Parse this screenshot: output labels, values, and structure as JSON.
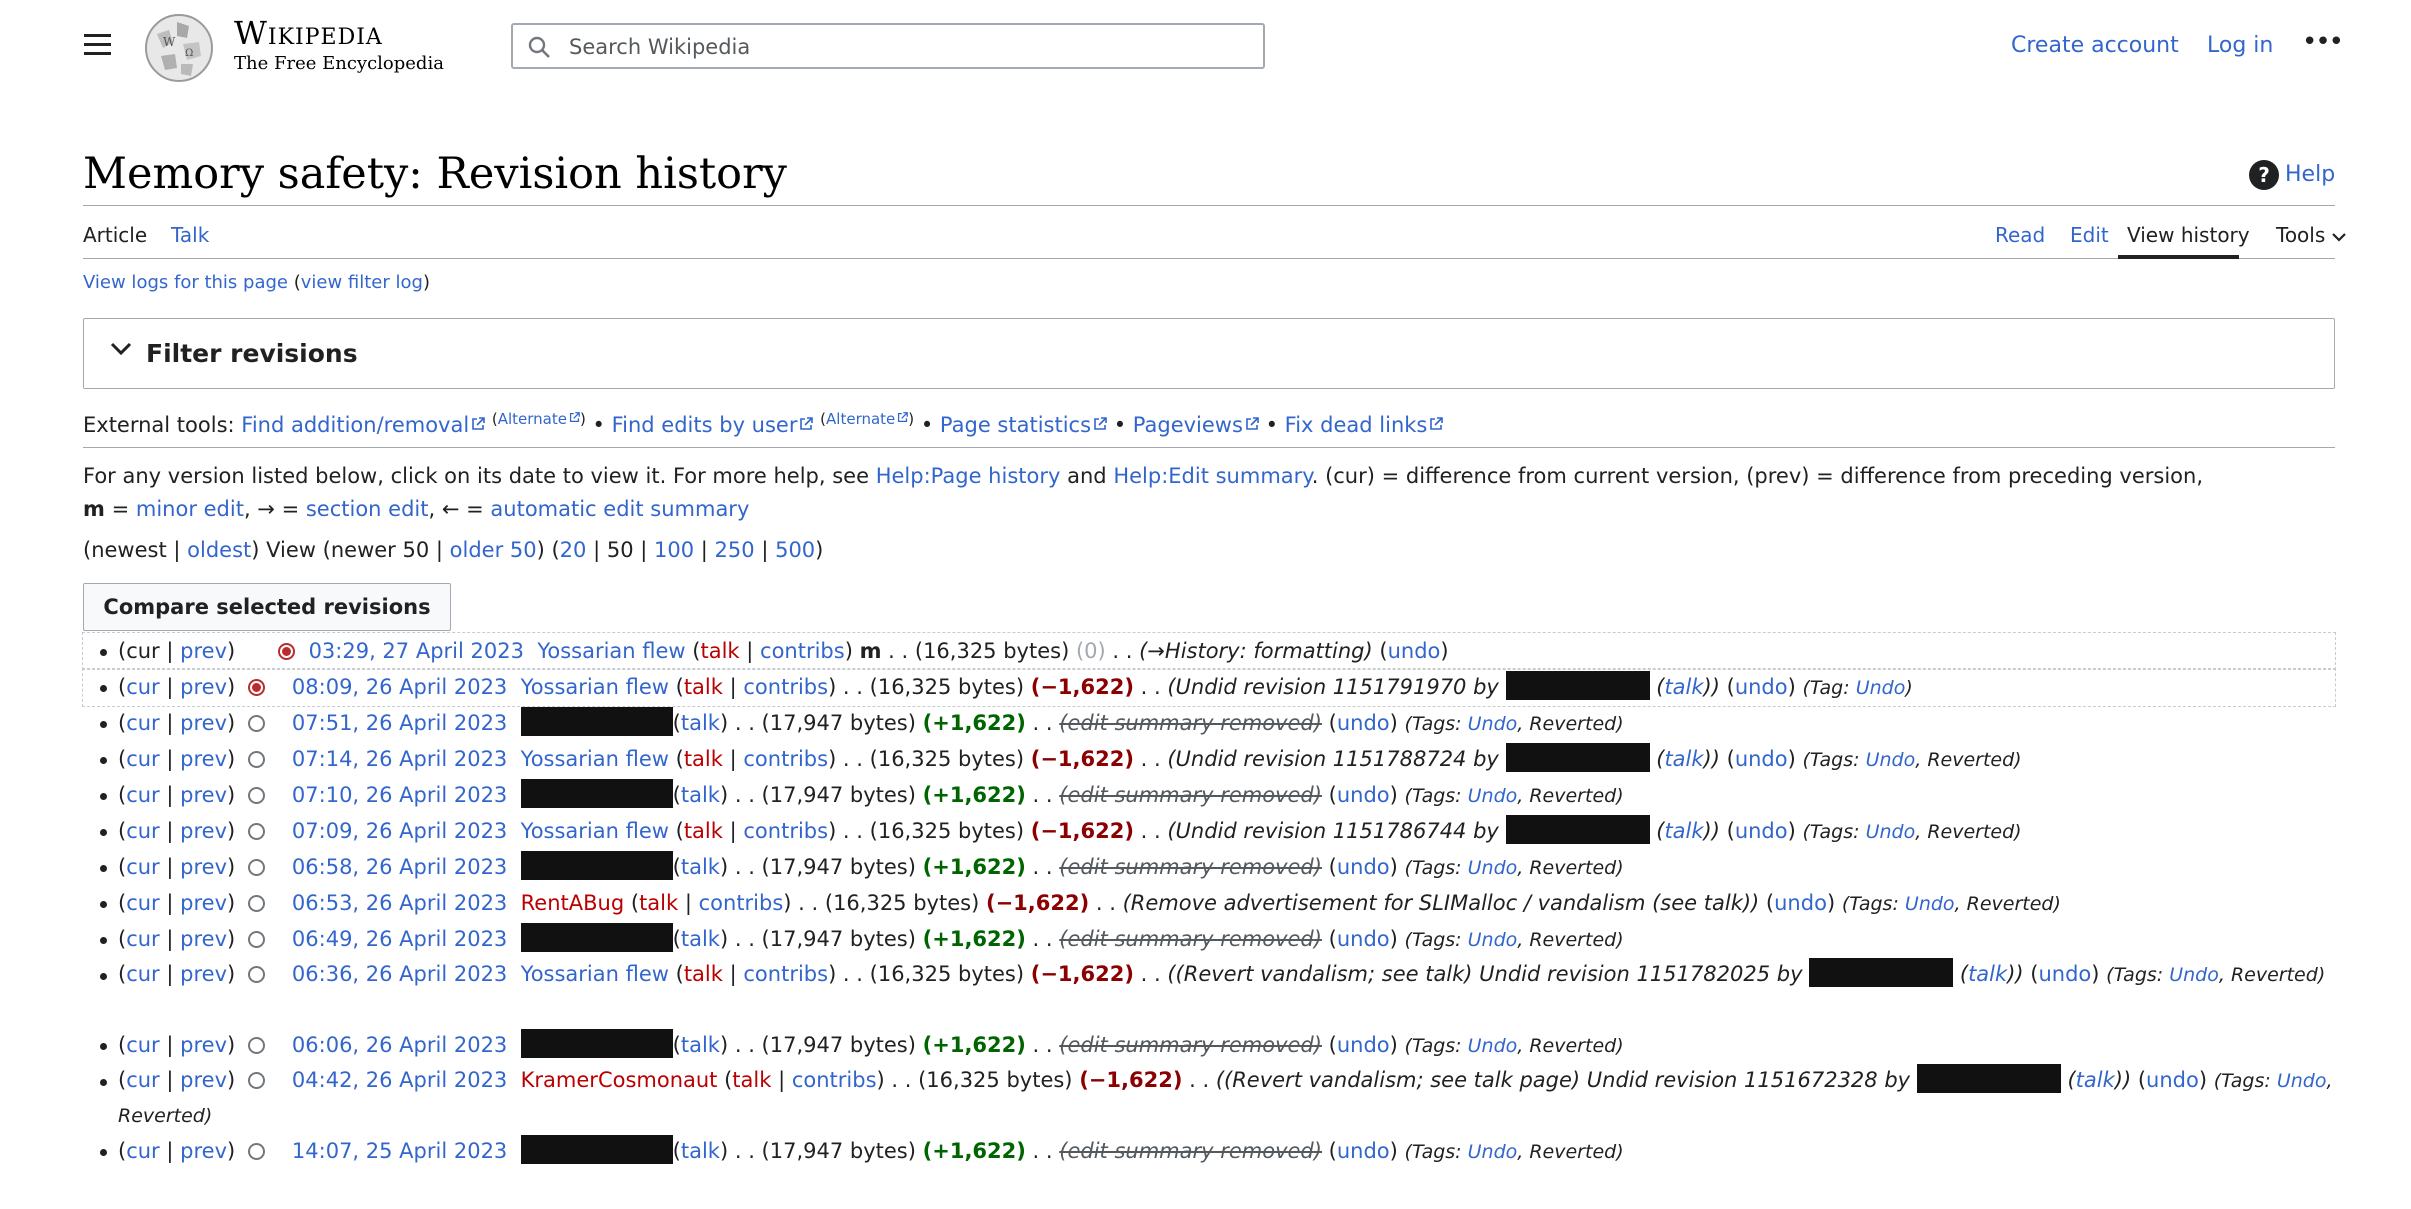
{
  "header": {
    "wordmark": "Wikipedia",
    "tagline": "The Free Encyclopedia",
    "search_placeholder": "Search Wikipedia",
    "create_account": "Create account",
    "log_in": "Log in"
  },
  "page": {
    "title": "Memory safety: Revision history",
    "help": "Help"
  },
  "tabs": {
    "article": "Article",
    "talk": "Talk",
    "read": "Read",
    "edit": "Edit",
    "view_history": "View history",
    "tools": "Tools"
  },
  "view_logs": "View logs for this page",
  "view_filter_log": "view filter log",
  "filter_title": "Filter revisions",
  "external_tools": {
    "label": "External tools:",
    "find_addition": "Find addition/removal",
    "alternate": "Alternate",
    "find_edits": "Find edits by user",
    "page_statistics": "Page statistics",
    "pageviews": "Pageviews",
    "fix_dead_links": "Fix dead links"
  },
  "legend": {
    "intro": "For any version listed below, click on its date to view it. For more help, see",
    "help_page_history": "Help:Page history",
    "and": "and",
    "help_edit_summary": "Help:Edit summary",
    "cur_desc": ". (cur) = difference from current version, (prev) = difference from preceding version,",
    "m": "m",
    "eq": "=",
    "minor_edit": "minor edit",
    "section_arrow": ", → =",
    "section_edit": "section edit",
    "auto_arrow": ", ← =",
    "automatic_edit_summary": "automatic edit summary"
  },
  "nav": {
    "newest": "newest",
    "oldest": "oldest",
    "view": "View",
    "newer_50": "newer 50",
    "older_50": "older 50",
    "limits": [
      "20",
      "50",
      "100",
      "250",
      "500"
    ]
  },
  "compare_button": "Compare selected revisions",
  "common": {
    "cur": "cur",
    "prev": "prev",
    "talk": "talk",
    "contribs": "contribs",
    "undo": "undo",
    "by": "by",
    "tag": "Tag:",
    "tags": "Tags:",
    "undo_tag": "Undo",
    "reverted": "Reverted",
    "summary_removed": "edit summary removed"
  },
  "revisions": [
    {
      "date": "03:29, 27 April 2023",
      "user": "Yossarian flew",
      "user_color": "#3366cc",
      "minor": "m",
      "bytes": "(16,325 bytes)",
      "diff": "(0)",
      "summary": "(→History: formatting)"
    },
    {
      "date": "08:09, 26 April 2023",
      "user": "Yossarian flew",
      "user_color": "#3366cc",
      "bytes": "(16,325 bytes)",
      "diff": "(−1,622)",
      "summary": "(Undid revision 1151791970 by"
    },
    {
      "date": "07:51, 26 April 2023",
      "bytes": "(17,947 bytes)",
      "diff": "(+1,622)"
    },
    {
      "date": "07:14, 26 April 2023",
      "user": "Yossarian flew",
      "user_color": "#3366cc",
      "bytes": "(16,325 bytes)",
      "diff": "(−1,622)",
      "summary": "(Undid revision 1151788724 by"
    },
    {
      "date": "07:10, 26 April 2023",
      "bytes": "(17,947 bytes)",
      "diff": "(+1,622)"
    },
    {
      "date": "07:09, 26 April 2023",
      "user": "Yossarian flew",
      "user_color": "#3366cc",
      "bytes": "(16,325 bytes)",
      "diff": "(−1,622)",
      "summary": "(Undid revision 1151786744 by"
    },
    {
      "date": "06:58, 26 April 2023",
      "bytes": "(17,947 bytes)",
      "diff": "(+1,622)"
    },
    {
      "date": "06:53, 26 April 2023",
      "user": "RentABug",
      "user_color": "#ba0000",
      "bytes": "(16,325 bytes)",
      "diff": "(−1,622)",
      "summary": "(Remove advertisement for SLIMalloc / vandalism (see talk))"
    },
    {
      "date": "06:49, 26 April 2023",
      "bytes": "(17,947 bytes)",
      "diff": "(+1,622)"
    },
    {
      "date": "06:36, 26 April 2023",
      "user": "Yossarian flew",
      "user_color": "#3366cc",
      "bytes": "(16,325 bytes)",
      "diff": "(−1,622)",
      "summary": "((Revert vandalism; see talk) Undid revision 1151782025 by"
    },
    {
      "date": "06:06, 26 April 2023",
      "bytes": "(17,947 bytes)",
      "diff": "(+1,622)"
    },
    {
      "date": "04:42, 26 April 2023",
      "user": "KramerCosmonaut",
      "user_color": "#ba0000",
      "bytes": "(16,325 bytes)",
      "diff": "(−1,622)",
      "summary": "((Revert vandalism; see talk page) Undid revision 1151672328 by"
    },
    {
      "date": "14:07, 25 April 2023",
      "bytes": "(17,947 bytes)",
      "diff": "(+1,622)"
    }
  ]
}
